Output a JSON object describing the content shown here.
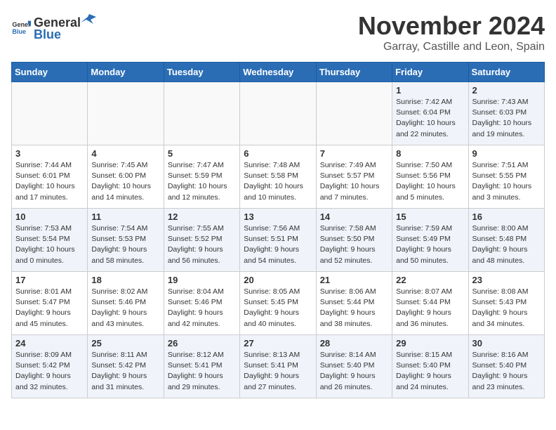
{
  "logo": {
    "general": "General",
    "blue": "Blue"
  },
  "header": {
    "month": "November 2024",
    "location": "Garray, Castille and Leon, Spain"
  },
  "days_of_week": [
    "Sunday",
    "Monday",
    "Tuesday",
    "Wednesday",
    "Thursday",
    "Friday",
    "Saturday"
  ],
  "weeks": [
    [
      {
        "day": "",
        "info": ""
      },
      {
        "day": "",
        "info": ""
      },
      {
        "day": "",
        "info": ""
      },
      {
        "day": "",
        "info": ""
      },
      {
        "day": "",
        "info": ""
      },
      {
        "day": "1",
        "info": "Sunrise: 7:42 AM\nSunset: 6:04 PM\nDaylight: 10 hours\nand 22 minutes."
      },
      {
        "day": "2",
        "info": "Sunrise: 7:43 AM\nSunset: 6:03 PM\nDaylight: 10 hours\nand 19 minutes."
      }
    ],
    [
      {
        "day": "3",
        "info": "Sunrise: 7:44 AM\nSunset: 6:01 PM\nDaylight: 10 hours\nand 17 minutes."
      },
      {
        "day": "4",
        "info": "Sunrise: 7:45 AM\nSunset: 6:00 PM\nDaylight: 10 hours\nand 14 minutes."
      },
      {
        "day": "5",
        "info": "Sunrise: 7:47 AM\nSunset: 5:59 PM\nDaylight: 10 hours\nand 12 minutes."
      },
      {
        "day": "6",
        "info": "Sunrise: 7:48 AM\nSunset: 5:58 PM\nDaylight: 10 hours\nand 10 minutes."
      },
      {
        "day": "7",
        "info": "Sunrise: 7:49 AM\nSunset: 5:57 PM\nDaylight: 10 hours\nand 7 minutes."
      },
      {
        "day": "8",
        "info": "Sunrise: 7:50 AM\nSunset: 5:56 PM\nDaylight: 10 hours\nand 5 minutes."
      },
      {
        "day": "9",
        "info": "Sunrise: 7:51 AM\nSunset: 5:55 PM\nDaylight: 10 hours\nand 3 minutes."
      }
    ],
    [
      {
        "day": "10",
        "info": "Sunrise: 7:53 AM\nSunset: 5:54 PM\nDaylight: 10 hours\nand 0 minutes."
      },
      {
        "day": "11",
        "info": "Sunrise: 7:54 AM\nSunset: 5:53 PM\nDaylight: 9 hours\nand 58 minutes."
      },
      {
        "day": "12",
        "info": "Sunrise: 7:55 AM\nSunset: 5:52 PM\nDaylight: 9 hours\nand 56 minutes."
      },
      {
        "day": "13",
        "info": "Sunrise: 7:56 AM\nSunset: 5:51 PM\nDaylight: 9 hours\nand 54 minutes."
      },
      {
        "day": "14",
        "info": "Sunrise: 7:58 AM\nSunset: 5:50 PM\nDaylight: 9 hours\nand 52 minutes."
      },
      {
        "day": "15",
        "info": "Sunrise: 7:59 AM\nSunset: 5:49 PM\nDaylight: 9 hours\nand 50 minutes."
      },
      {
        "day": "16",
        "info": "Sunrise: 8:00 AM\nSunset: 5:48 PM\nDaylight: 9 hours\nand 48 minutes."
      }
    ],
    [
      {
        "day": "17",
        "info": "Sunrise: 8:01 AM\nSunset: 5:47 PM\nDaylight: 9 hours\nand 45 minutes."
      },
      {
        "day": "18",
        "info": "Sunrise: 8:02 AM\nSunset: 5:46 PM\nDaylight: 9 hours\nand 43 minutes."
      },
      {
        "day": "19",
        "info": "Sunrise: 8:04 AM\nSunset: 5:46 PM\nDaylight: 9 hours\nand 42 minutes."
      },
      {
        "day": "20",
        "info": "Sunrise: 8:05 AM\nSunset: 5:45 PM\nDaylight: 9 hours\nand 40 minutes."
      },
      {
        "day": "21",
        "info": "Sunrise: 8:06 AM\nSunset: 5:44 PM\nDaylight: 9 hours\nand 38 minutes."
      },
      {
        "day": "22",
        "info": "Sunrise: 8:07 AM\nSunset: 5:44 PM\nDaylight: 9 hours\nand 36 minutes."
      },
      {
        "day": "23",
        "info": "Sunrise: 8:08 AM\nSunset: 5:43 PM\nDaylight: 9 hours\nand 34 minutes."
      }
    ],
    [
      {
        "day": "24",
        "info": "Sunrise: 8:09 AM\nSunset: 5:42 PM\nDaylight: 9 hours\nand 32 minutes."
      },
      {
        "day": "25",
        "info": "Sunrise: 8:11 AM\nSunset: 5:42 PM\nDaylight: 9 hours\nand 31 minutes."
      },
      {
        "day": "26",
        "info": "Sunrise: 8:12 AM\nSunset: 5:41 PM\nDaylight: 9 hours\nand 29 minutes."
      },
      {
        "day": "27",
        "info": "Sunrise: 8:13 AM\nSunset: 5:41 PM\nDaylight: 9 hours\nand 27 minutes."
      },
      {
        "day": "28",
        "info": "Sunrise: 8:14 AM\nSunset: 5:40 PM\nDaylight: 9 hours\nand 26 minutes."
      },
      {
        "day": "29",
        "info": "Sunrise: 8:15 AM\nSunset: 5:40 PM\nDaylight: 9 hours\nand 24 minutes."
      },
      {
        "day": "30",
        "info": "Sunrise: 8:16 AM\nSunset: 5:40 PM\nDaylight: 9 hours\nand 23 minutes."
      }
    ]
  ]
}
